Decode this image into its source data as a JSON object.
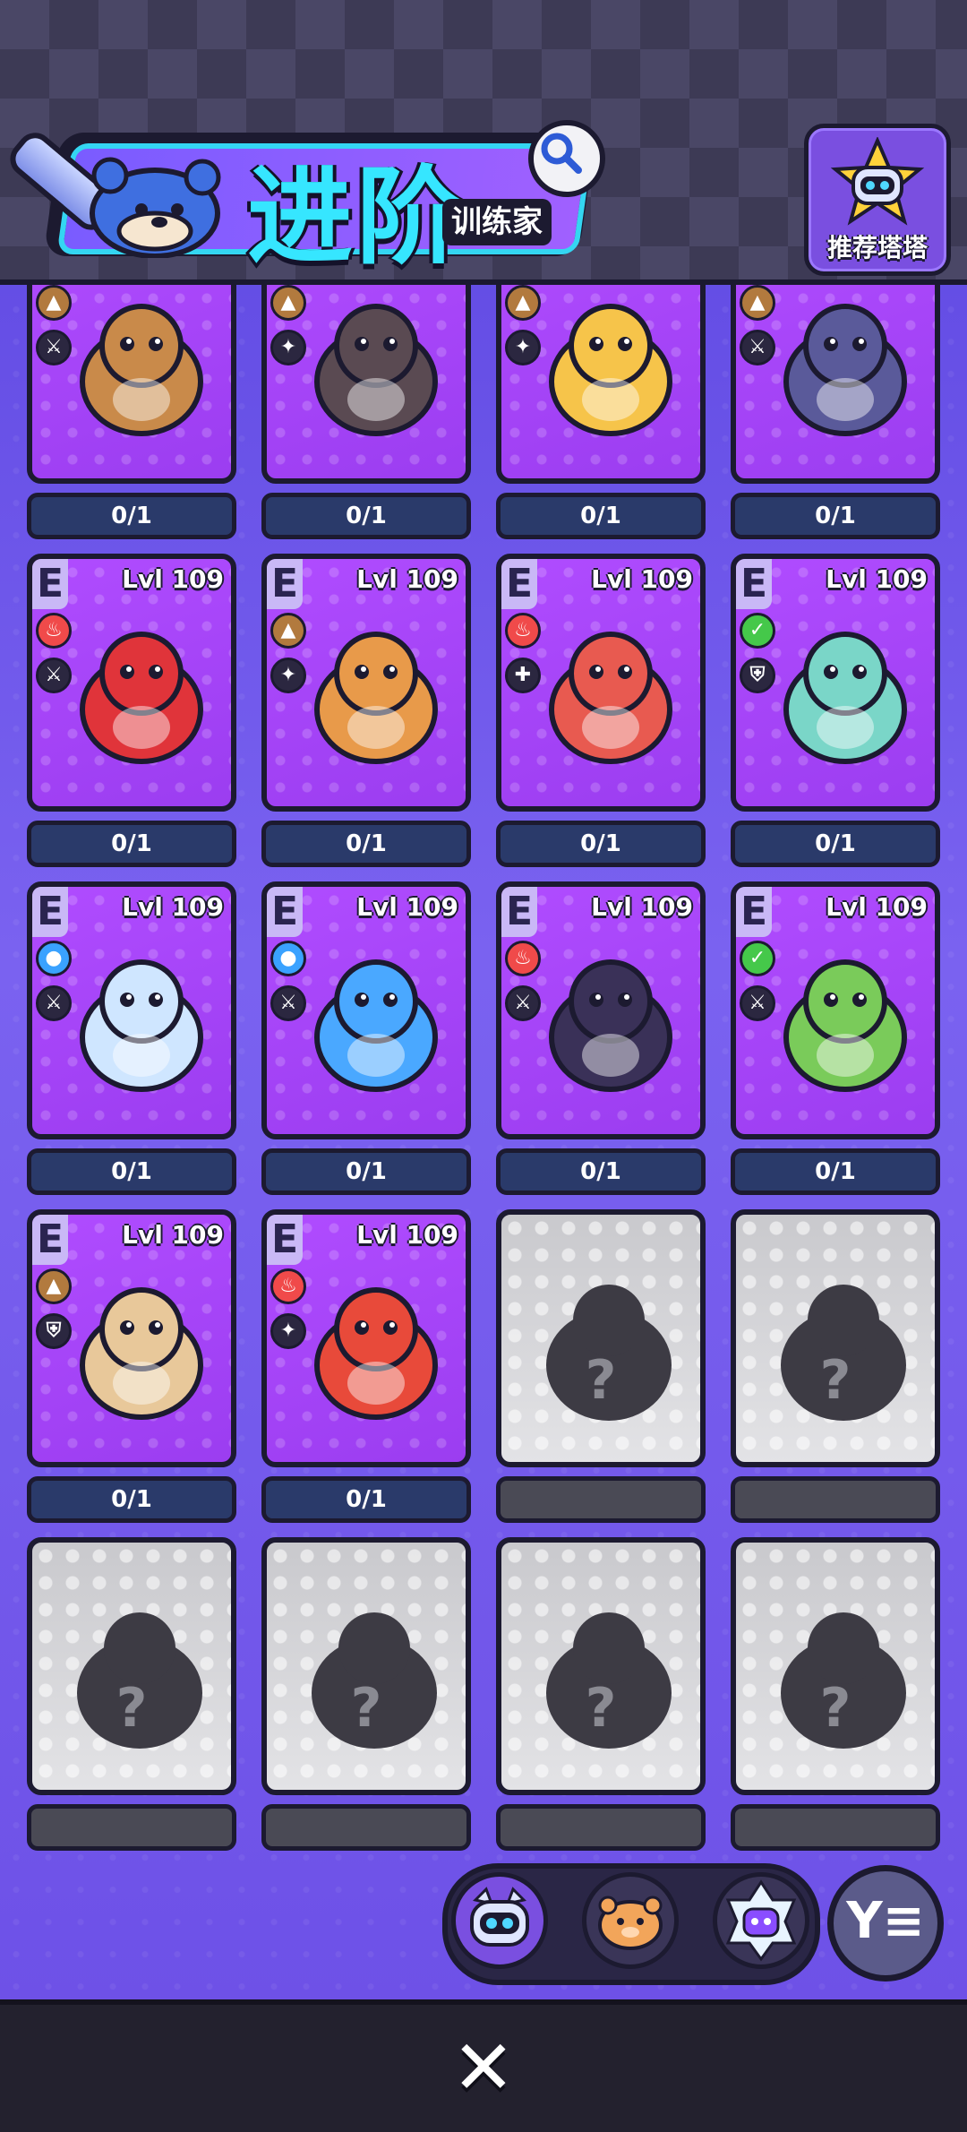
{
  "header": {
    "title": "进阶",
    "subtitle": "训练家",
    "recommend_label": "推荐塔塔"
  },
  "icons": {
    "search": "search-icon",
    "close": "close-icon",
    "filter": "filter-icon"
  },
  "colors": {
    "card_purple": "#a446f8",
    "card_locked": "#d6d6da",
    "accent_cyan": "#36e6ff",
    "background": "#6a52e6"
  },
  "rows": [
    {
      "cards": [
        {
          "rank": "",
          "level": "",
          "element": "earth",
          "role": "attack",
          "monster": "monkey-cage",
          "count": "0/1",
          "locked": false
        },
        {
          "rank": "",
          "level": "",
          "element": "earth",
          "role": "magic",
          "monster": "seal",
          "count": "0/1",
          "locked": false
        },
        {
          "rank": "",
          "level": "",
          "element": "earth",
          "role": "magic",
          "monster": "fox",
          "count": "0/1",
          "locked": false
        },
        {
          "rank": "",
          "level": "",
          "element": "earth",
          "role": "attack",
          "monster": "rhino",
          "count": "0/1",
          "locked": false
        }
      ]
    },
    {
      "cards": [
        {
          "rank": "E",
          "level": "Lvl 109",
          "element": "fire",
          "role": "attack",
          "monster": "red-bird",
          "count": "0/1",
          "locked": false
        },
        {
          "rank": "E",
          "level": "Lvl 109",
          "element": "earth",
          "role": "magic",
          "monster": "kangaroo",
          "count": "0/1",
          "locked": false
        },
        {
          "rank": "E",
          "level": "Lvl 109",
          "element": "fire",
          "role": "heal",
          "monster": "pig-bowl",
          "count": "0/1",
          "locked": false
        },
        {
          "rank": "E",
          "level": "Lvl 109",
          "element": "leaf",
          "role": "defense",
          "monster": "slime-bag",
          "count": "0/1",
          "locked": false
        }
      ]
    },
    {
      "cards": [
        {
          "rank": "E",
          "level": "Lvl 109",
          "element": "water",
          "role": "attack",
          "monster": "jellyfish",
          "count": "0/1",
          "locked": false
        },
        {
          "rank": "E",
          "level": "Lvl 109",
          "element": "water",
          "role": "attack",
          "monster": "octopus",
          "count": "0/1",
          "locked": false
        },
        {
          "rank": "E",
          "level": "Lvl 109",
          "element": "fire",
          "role": "attack",
          "monster": "lucky-cat",
          "count": "0/1",
          "locked": false
        },
        {
          "rank": "E",
          "level": "Lvl 109",
          "element": "leaf",
          "role": "attack",
          "monster": "plant-creature",
          "count": "0/1",
          "locked": false
        }
      ]
    },
    {
      "cards": [
        {
          "rank": "E",
          "level": "Lvl 109",
          "element": "earth",
          "role": "defense",
          "monster": "mushroom-bear",
          "count": "0/1",
          "locked": false
        },
        {
          "rank": "E",
          "level": "Lvl 109",
          "element": "fire",
          "role": "magic",
          "monster": "red-fish",
          "count": "0/1",
          "locked": false
        },
        {
          "rank": "",
          "level": "",
          "element": "",
          "role": "",
          "monster": "unknown",
          "count": "",
          "locked": true,
          "question": "?"
        },
        {
          "rank": "",
          "level": "",
          "element": "",
          "role": "",
          "monster": "unknown",
          "count": "",
          "locked": true,
          "question": "?"
        }
      ]
    },
    {
      "cards": [
        {
          "rank": "",
          "level": "",
          "element": "",
          "role": "",
          "monster": "unknown",
          "count": "",
          "locked": true,
          "question": "?"
        },
        {
          "rank": "",
          "level": "",
          "element": "",
          "role": "",
          "monster": "unknown",
          "count": "",
          "locked": true,
          "question": "?"
        },
        {
          "rank": "",
          "level": "",
          "element": "",
          "role": "",
          "monster": "unknown",
          "count": "",
          "locked": true,
          "question": "?"
        },
        {
          "rank": "",
          "level": "",
          "element": "",
          "role": "",
          "monster": "unknown",
          "count": "",
          "locked": true,
          "question": "?"
        }
      ]
    }
  ],
  "bottom_nav": {
    "tabs": [
      {
        "name": "tata-tab",
        "icon": "robot-cat-icon",
        "active": true
      },
      {
        "name": "pet-tab",
        "icon": "hamster-icon",
        "active": false
      },
      {
        "name": "crystal-tab",
        "icon": "crystal-cat-icon",
        "active": false
      }
    ],
    "filter_glyph": "Y≡",
    "close_glyph": "✕"
  }
}
